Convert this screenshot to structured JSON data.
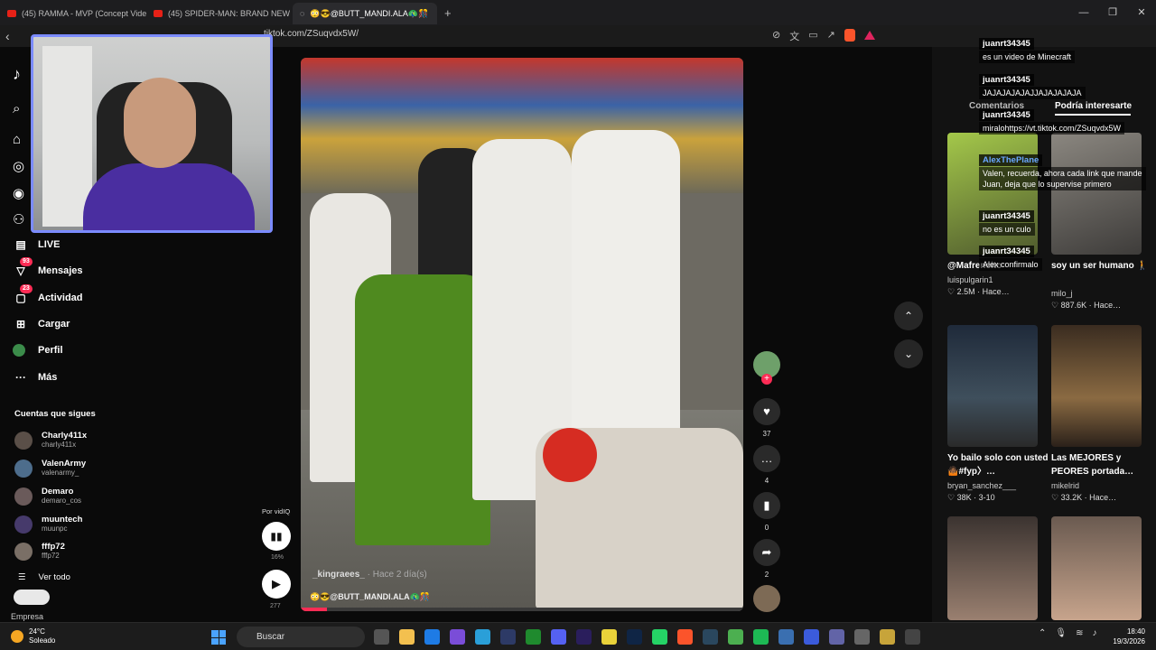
{
  "tabs": [
    {
      "label": "(45) RAMMA - MVP (Concept Video)"
    },
    {
      "label": "(45) SPIDER-MAN: BRAND NEW DAY"
    },
    {
      "label": "😳😎@BUTT_MANDI.ALA🦚🎊"
    }
  ],
  "address": {
    "url": "tiktok.com/ZSuqvdx5W/"
  },
  "nav": {
    "live": "LIVE",
    "mensajes": "Mensajes",
    "mensajes_badge": "93",
    "actividad": "Actividad",
    "actividad_badge": "23",
    "cargar": "Cargar",
    "perfil": "Perfil",
    "mas": "Más"
  },
  "following": {
    "title": "Cuentas que sigues",
    "accounts": [
      {
        "name": "Charly411x",
        "handle": "charly411x"
      },
      {
        "name": "ValenArmy",
        "handle": "valenarmy_"
      },
      {
        "name": "Demaro",
        "handle": "demaro_cos"
      },
      {
        "name": "muuntech",
        "handle": "muunpc"
      },
      {
        "name": "fffp72",
        "handle": "fffp72"
      }
    ],
    "see_all": "Ver todo"
  },
  "empresa": "Empresa",
  "vidiq": {
    "label": "Por vidIQ",
    "pct": "16%",
    "count": "277"
  },
  "video": {
    "author": "_kingraees_",
    "time": "· Hace 2 día(s)",
    "subtitle": "😳😎@BUTT_MANDI.ALA🦚🎊",
    "progress": 0.06
  },
  "actions": {
    "likes": "37",
    "comments": "4",
    "saves": "0",
    "shares": "2"
  },
  "right": {
    "tab_comments": "Comentarios",
    "tab_interest": "Podría interesarte",
    "cards": [
      {
        "title": "@Mafrencito",
        "user": "luispulgarin1",
        "stat": "♡ 2.5M · Hace…"
      },
      {
        "title": "soy un ser humano 🚶",
        "user": "milo_j",
        "stat": "♡ 887.6K · Hace…"
      },
      {
        "title": "Yo bailo solo con usted🤷🏾#fyp〉…",
        "user": "bryan_sanchez___",
        "stat": "♡ 38K · 3-10"
      },
      {
        "title": "Las MEJORES y PEORES portada…",
        "user": "mikelrid",
        "stat": "♡ 33.2K · Hace…"
      }
    ]
  },
  "chat": [
    {
      "user": "juanrt34345",
      "msg": "es un video de Minecraft"
    },
    {
      "user": "juanrt34345",
      "msg": "JAJAJAJAJAJJAJAJAJAJA"
    },
    {
      "user": "juanrt34345",
      "msg": "miralohttps://vt.tiktok.com/ZSuqvdx5W"
    },
    {
      "user": "AlexThePlane",
      "msg": "Valen, recuerda, ahora cada link que mande Juan, deja que lo supervise primero"
    },
    {
      "user": "juanrt34345",
      "msg": "no es un culo"
    },
    {
      "user": "juanrt34345",
      "msg": "Alex confirmalo"
    }
  ],
  "taskbar": {
    "temp": "24°C",
    "weather": "Soleado",
    "search": "Buscar",
    "time": "18:40",
    "date": "19/3/2026"
  }
}
